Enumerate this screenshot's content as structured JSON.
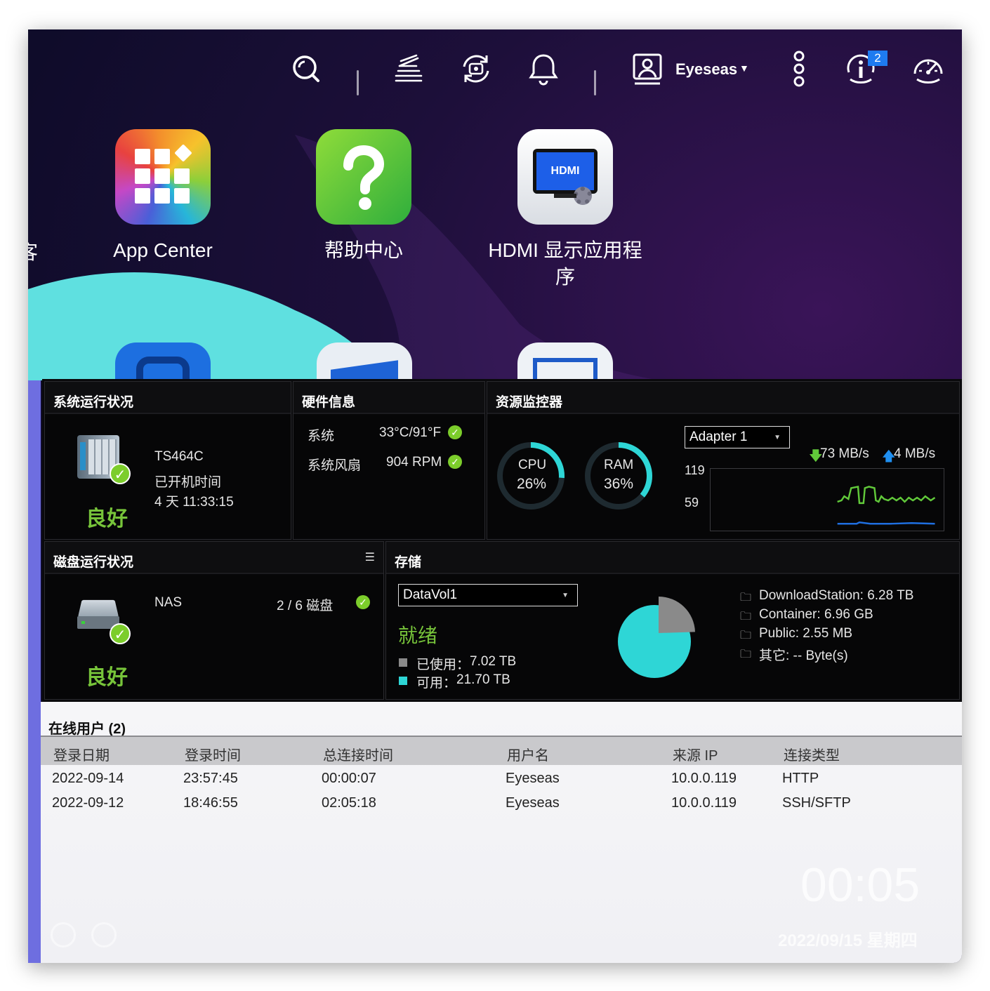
{
  "topbar": {
    "username": "Eyeseas",
    "notification_badge": "2",
    "icons": [
      "search-icon",
      "task-list-icon",
      "sync-icon",
      "bell-icon",
      "user-icon",
      "more-icon",
      "info-icon",
      "dashboard-icon"
    ]
  },
  "desktop": {
    "apps": [
      {
        "label": "App Center",
        "icon": "app-center-icon"
      },
      {
        "label": "帮助中心",
        "icon": "help-center-icon"
      },
      {
        "label": "HDMI 显示应用程序",
        "icon": "hdmi-icon",
        "badge_text": "HDMI"
      }
    ],
    "left_cut_label": "客"
  },
  "system_status": {
    "title": "系统运行状况",
    "model": "TS464C",
    "uptime_label": "已开机时间",
    "uptime_value": "4 天 11:33:15",
    "status": "良好"
  },
  "hardware": {
    "title": "硬件信息",
    "rows": [
      {
        "label": "系统",
        "value": "33°C/91°F"
      },
      {
        "label": "系统风扇",
        "value": "904 RPM"
      }
    ]
  },
  "resource": {
    "title": "资源监控器",
    "cpu_label": "CPU",
    "cpu_value": "26%",
    "cpu_fraction": 0.26,
    "ram_label": "RAM",
    "ram_value": "36%",
    "ram_fraction": 0.36,
    "adapter": "Adapter 1",
    "download": "73 MB/s",
    "upload": "4 MB/s",
    "axis_top": "119",
    "axis_mid": "59",
    "colors": {
      "accent": "#2ed6d6",
      "download_line": "#61c93a",
      "upload_line": "#1f6fe0"
    }
  },
  "disk_status": {
    "title": "磁盘运行状况",
    "name": "NAS",
    "disks": "2 / 6 磁盘",
    "status": "良好"
  },
  "storage": {
    "title": "存储",
    "volume": "DataVol1",
    "state": "就绪",
    "used_label": "已使用：",
    "used_value": "7.02 TB",
    "free_label": "可用：",
    "free_value": "21.70 TB",
    "used_fraction": 0.245,
    "folders": [
      "DownloadStation: 6.28 TB",
      "Container: 6.96 GB",
      "Public: 2.55 MB",
      "其它: -- Byte(s)"
    ],
    "colors": {
      "used": "#8a8a8a",
      "free": "#2ed6d6"
    }
  },
  "online_users": {
    "title": "在线用户 (2)",
    "columns": [
      "登录日期",
      "登录时间",
      "总连接时间",
      "用户名",
      "来源 IP",
      "连接类型"
    ],
    "rows": [
      [
        "2022-09-14",
        "23:57:45",
        "00:00:07",
        "Eyeseas",
        "10.0.0.119",
        "HTTP"
      ],
      [
        "2022-09-12",
        "18:46:55",
        "02:05:18",
        "Eyeseas",
        "10.0.0.119",
        "SSH/SFTP"
      ]
    ]
  },
  "clock": {
    "time": "00:05",
    "date": "2022/09/15 星期四"
  }
}
